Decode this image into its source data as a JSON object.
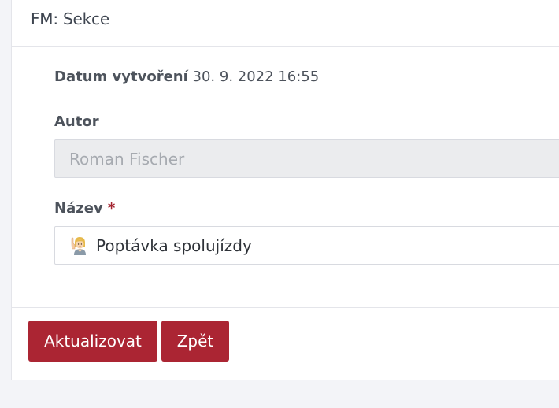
{
  "header": {
    "title": "FM: Sekce"
  },
  "form": {
    "created": {
      "label": "Datum vytvoření",
      "value": "30. 9. 2022 16:55"
    },
    "author": {
      "label": "Autor",
      "value": "Roman Fischer"
    },
    "name": {
      "label": "Název",
      "required_mark": "*",
      "value": "Poptávka spolujízdy",
      "icon": "person-raising-hand-emoji-icon"
    }
  },
  "actions": {
    "update_label": "Aktualizovat",
    "back_label": "Zpět"
  },
  "colors": {
    "primary_button": "#ab2533",
    "required_star": "#a3232f",
    "page_background": "#f3f4f8"
  }
}
